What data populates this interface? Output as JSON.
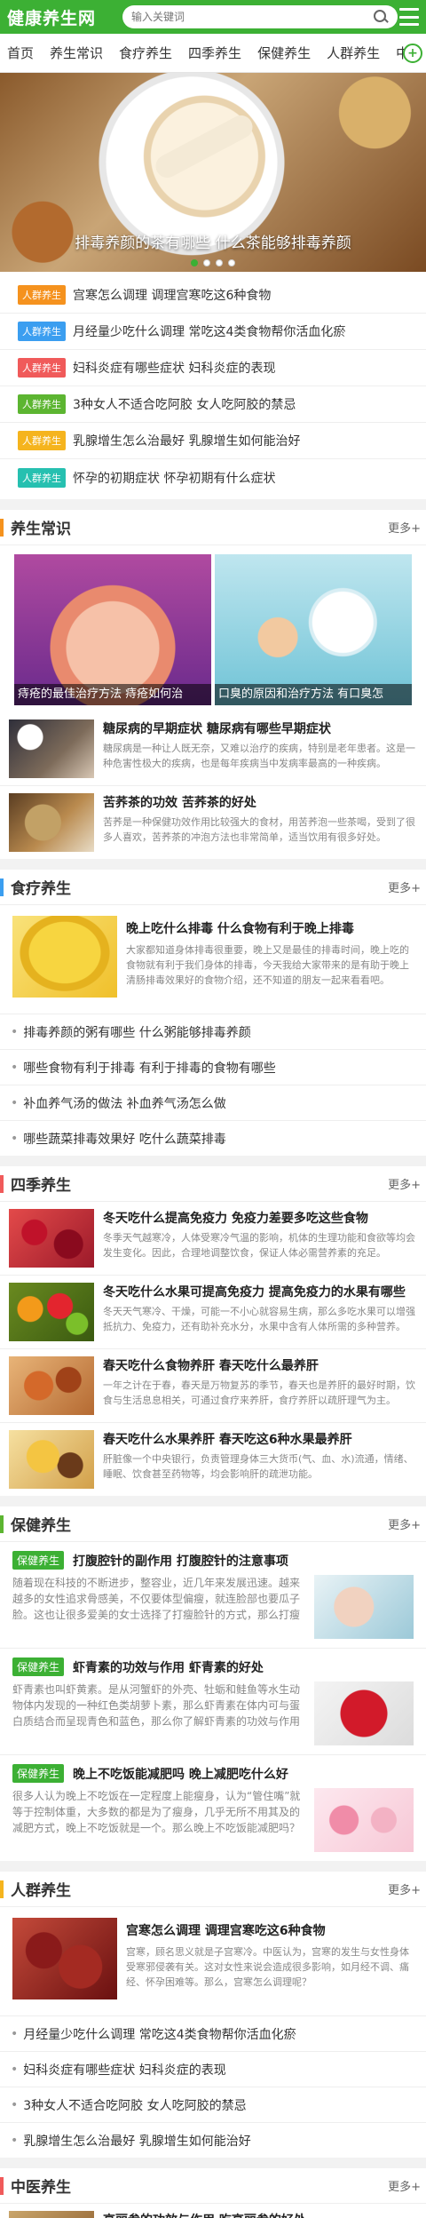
{
  "header": {
    "logo": "健康养生网",
    "search_placeholder": "输入关键词",
    "brand_color": "#3cb034"
  },
  "nav": {
    "items": [
      "首页",
      "养生常识",
      "食疗养生",
      "四季养生",
      "保健养生",
      "人群养生",
      "中"
    ]
  },
  "banner": {
    "caption": "排毒养颜的茶有哪些 什么茶能够排毒养颜",
    "dots": 4,
    "active_dot": 1
  },
  "hot_list": [
    {
      "tag": "人群养生",
      "color": "#f5921e",
      "text": "宫寒怎么调理 调理宫寒吃这6种食物"
    },
    {
      "tag": "人群养生",
      "color": "#3b9ef0",
      "text": "月经量少吃什么调理 常吃这4类食物帮你活血化瘀"
    },
    {
      "tag": "人群养生",
      "color": "#f05a5a",
      "text": "妇科炎症有哪些症状 妇科炎症的表现"
    },
    {
      "tag": "人群养生",
      "color": "#5cb531",
      "text": "3种女人不适合吃阿胶 女人吃阿胶的禁忌"
    },
    {
      "tag": "人群养生",
      "color": "#f5b41e",
      "text": "乳腺增生怎么治最好 乳腺增生如何能治好"
    },
    {
      "tag": "人群养生",
      "color": "#26c0b0",
      "text": "怀孕的初期症状 怀孕初期有什么症状"
    }
  ],
  "more_label": "更多+",
  "sec1": {
    "title": "养生常识",
    "bar": "#f5921e",
    "cards": [
      "痔疮的最佳治疗方法 痔疮如何治",
      "口臭的原因和治疗方法 有口臭怎"
    ],
    "articles": [
      {
        "title": "糖尿病的早期症状 糖尿病有哪些早期症状",
        "desc": "糖尿病是一种让人既无奈，又难以治疗的疾病，特别是老年患者。这是一种危害性极大的疾病，也是每年疾病当中发病率最高的一种疾病。"
      },
      {
        "title": "苦荞茶的功效 苦荞茶的好处",
        "desc": "苦荞是一种保健功效作用比较强大的食材，用苦荞泡一些茶喝，受到了很多人喜欢，苦荞茶的冲泡方法也非常简单，适当饮用有很多好处。"
      }
    ]
  },
  "sec2": {
    "title": "食疗养生",
    "bar": "#3b9ef0",
    "feature": {
      "title": "晚上吃什么排毒 什么食物有利于晚上排毒",
      "desc": "大家都知道身体排毒很重要，晚上又是最佳的排毒时间，晚上吃的食物就有利于我们身体的排毒，今天我给大家带来的是有助于晚上清肠排毒效果好的食物介绍，还不知道的朋友一起来看看吧。"
    },
    "links": [
      "排毒养颜的粥有哪些 什么粥能够排毒养颜",
      "哪些食物有利于排毒 有利于排毒的食物有哪些",
      "补血养气汤的做法 补血养气汤怎么做",
      "哪些蔬菜排毒效果好 吃什么蔬菜排毒"
    ]
  },
  "sec3": {
    "title": "四季养生",
    "bar": "#f05a5a",
    "articles": [
      {
        "title": "冬天吃什么提高免疫力 免疫力差要多吃这些食物",
        "desc": "冬季天气越寒冷，人体受寒冷气温的影响，机体的生理功能和食欲等均会发生变化。因此，合理地调整饮食，保证人体必需营养素的充足。"
      },
      {
        "title": "冬天吃什么水果可提高免疫力 提高免疫力的水果有哪些",
        "desc": "冬天天气寒冷、干燥，可能一不小心就容易生病，那么多吃水果可以增强抵抗力、免疫力，还有助补充水分，水果中含有人体所需的多种营养。"
      },
      {
        "title": "春天吃什么食物养肝 春天吃什么最养肝",
        "desc": "一年之计在于春，春天是万物复苏的季节，春天也是养肝的最好时期，饮食与生活息息相关，可通过食疗来养肝，食疗养肝以疏肝理气为主。"
      },
      {
        "title": "春天吃什么水果养肝 春天吃这6种水果最养肝",
        "desc": "肝脏像一个中央银行，负责管理身体三大货币(气、血、水)流通，情绪、睡眠、饮食甚至药物等，均会影响肝的疏泄功能。"
      }
    ]
  },
  "sec4": {
    "title": "保健养生",
    "bar": "#5cb531",
    "badge": "保健养生",
    "articles": [
      {
        "title": "打腹腔针的副作用 打腹腔针的注意事项",
        "desc": "随着现在科技的不断进步，整容业，近几年来发展迅速。越来越多的女性追求骨感美，不仅要体型偏瘦，就连脸部也要瓜子脸。这也让很多爱美的女士选择了打瘦脸针的方式，那么打瘦脸针的副作用有哪些呢？下面就为大家介绍。"
      },
      {
        "title": "虾青素的功效与作用 虾青素的好处",
        "desc": "虾青素也叫虾黄素。是从河蟹虾的外壳、牡蛎和鲑鱼等水生动物体内发现的一种红色类胡萝卜素，那么虾青素在体内可与蛋白质结合而呈现青色和蓝色，那么你了解虾青素的功效与作用吗？下面为大家详细介绍。"
      },
      {
        "title": "晚上不吃饭能减肥吗 晚上减肥吃什么好",
        "desc": "很多人认为晚上不吃饭在一定程度上能瘦身，认为“管住嘴”就等于控制体重，大多数的都是为了瘦身，几乎无所不用其及的减肥方式，晚上不吃饭就是一个。那么晚上不吃饭能减肥吗？下面我为大家揭晓。"
      }
    ]
  },
  "sec5": {
    "title": "人群养生",
    "bar": "#f5b41e",
    "feature": {
      "title": "宫寒怎么调理 调理宫寒吃这6种食物",
      "desc": "宫寒，顾名思义就是子宫寒冷。中医认为，宫寒的发生与女性身体受寒邪侵袭有关。这对女性来说会造成很多影响，如月经不调、痛经、怀孕困难等。那么，宫寒怎么调理呢？"
    },
    "links": [
      "月经量少吃什么调理 常吃这4类食物帮你活血化瘀",
      "妇科炎症有哪些症状 妇科炎症的表现",
      "3种女人不适合吃阿胶 女人吃阿胶的禁忌",
      "乳腺增生怎么治最好 乳腺增生如何能治好"
    ]
  },
  "sec6": {
    "title": "中医养生",
    "bar": "#f05a5a",
    "peek_title": "高丽参的功效与作用 吃高丽参的好处"
  }
}
